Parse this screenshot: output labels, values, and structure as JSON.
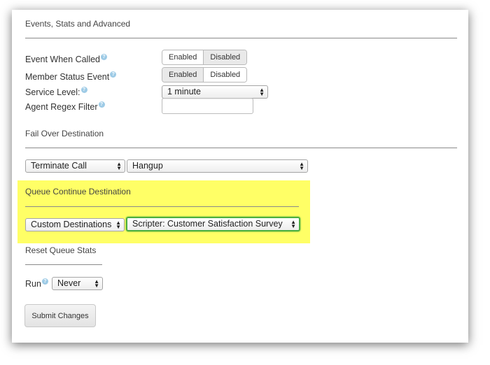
{
  "sections": {
    "events": "Events, Stats and Advanced",
    "failover": "Fail Over Destination",
    "queue_continue": "Queue Continue Destination",
    "reset": "Reset Queue Stats"
  },
  "fields": {
    "event_when_called": {
      "label": "Event When Called",
      "on": "Enabled",
      "off": "Disabled",
      "selected": "Enabled"
    },
    "member_status_event": {
      "label": "Member Status Event",
      "on": "Enabled",
      "off": "Disabled",
      "selected": "Disabled"
    },
    "service_level": {
      "label": "Service Level:",
      "value": "1 minute"
    },
    "agent_regex_filter": {
      "label": "Agent Regex Filter",
      "value": ""
    },
    "run": {
      "label": "Run",
      "value": "Never"
    }
  },
  "failover": {
    "type": "Terminate Call",
    "target": "Hangup"
  },
  "queue_continue": {
    "type": "Custom Destinations",
    "target": "Scripter: Customer Satisfaction Survey"
  },
  "help_glyph": "?",
  "submit_label": "Submit Changes",
  "colors": {
    "highlight": "#ffff66",
    "focus": "#4caf3f",
    "help": "#9ecbe6"
  }
}
